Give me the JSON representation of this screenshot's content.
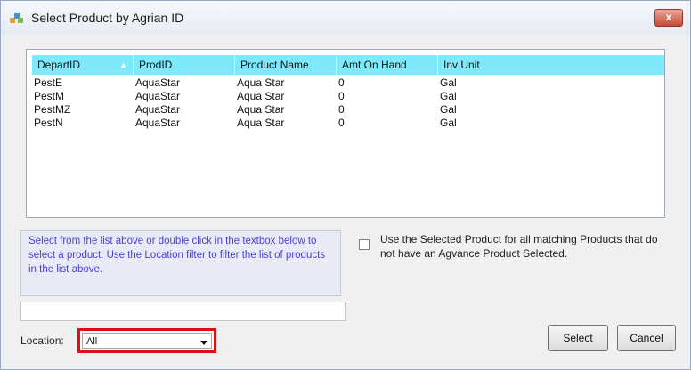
{
  "window": {
    "title": "Select Product by Agrian ID",
    "close_label": "x"
  },
  "table": {
    "columns": [
      "DepartID",
      "ProdID",
      "Product Name",
      "Amt On Hand",
      "Inv Unit"
    ],
    "sort_indicator": "▲",
    "rows": [
      [
        "PestE",
        "AquaStar",
        "Aqua Star",
        "0",
        "Gal"
      ],
      [
        "PestM",
        "AquaStar",
        "Aqua Star",
        "0",
        "Gal"
      ],
      [
        "PestMZ",
        "AquaStar",
        "Aqua Star",
        "0",
        "Gal"
      ],
      [
        "PestN",
        "AquaStar",
        "Aqua Star",
        "0",
        "Gal"
      ]
    ]
  },
  "instructions": "Select from the list above or double click in the textbox below to select a product.  Use the Location filter to filter the list of products in the list above.",
  "search": {
    "value": ""
  },
  "checkbox": {
    "label": "Use the Selected Product for all matching Products that do not have an Agvance Product Selected.",
    "checked": false
  },
  "location": {
    "label": "Location:",
    "value": "All"
  },
  "buttons": {
    "select": "Select",
    "cancel": "Cancel"
  },
  "colors": {
    "header": "#7de9fb",
    "instruction_text": "#4b3fd6",
    "highlight_border": "#e01010"
  }
}
